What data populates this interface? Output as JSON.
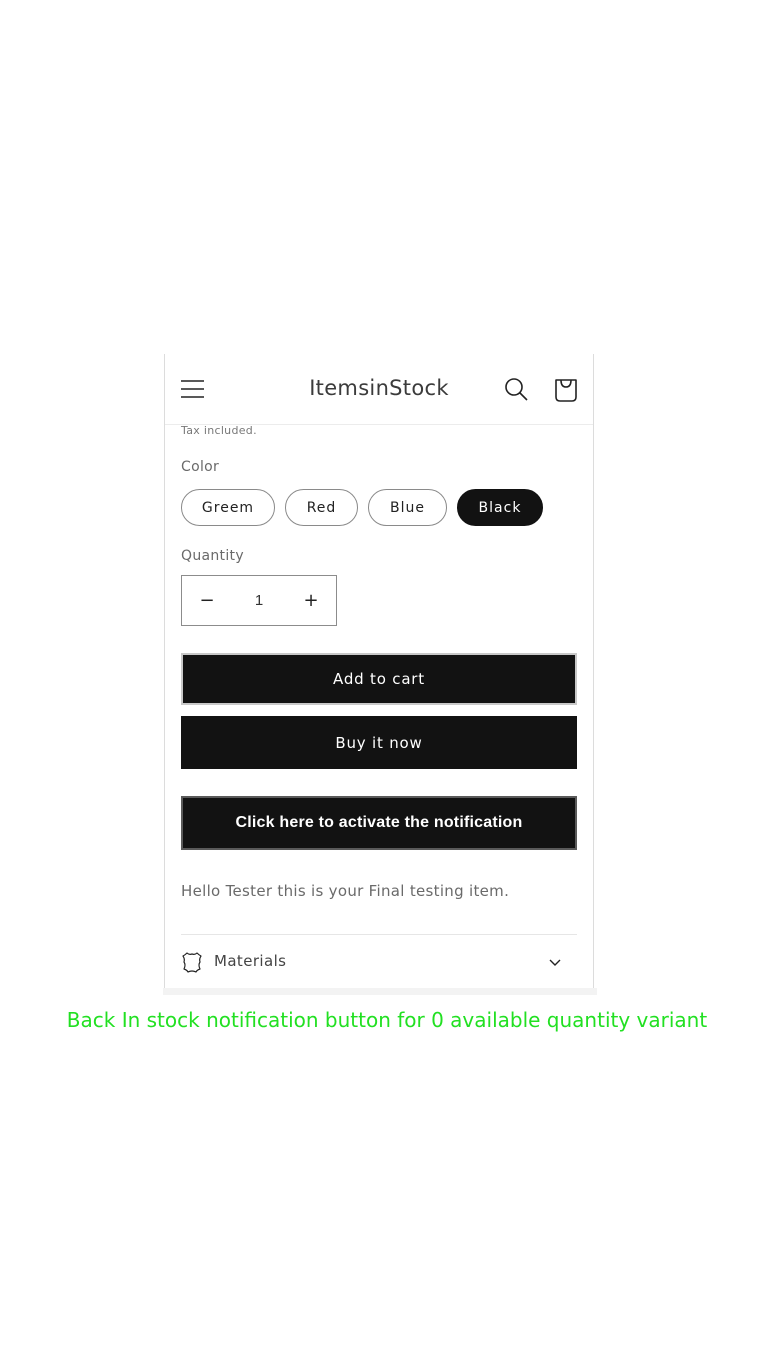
{
  "header": {
    "store_name": "ItemsinStock",
    "icons": [
      "hamburger-menu-icon",
      "search-icon",
      "cart-bag-icon"
    ]
  },
  "product": {
    "tax_note": "Tax included.",
    "color_label": "Color",
    "colors": [
      {
        "label": "Greem",
        "selected": false
      },
      {
        "label": "Red",
        "selected": false
      },
      {
        "label": "Blue",
        "selected": false
      },
      {
        "label": "Black",
        "selected": true
      }
    ],
    "quantity_label": "Quantity",
    "quantity_value": "1",
    "decrease_symbol": "−",
    "increase_symbol": "+",
    "add_to_cart_label": "Add to cart",
    "buy_now_label": "Buy it now",
    "notify_label": "Click here to activate the notification",
    "description": "Hello Tester this is your Final testing item.",
    "accordion": {
      "label": "Materials",
      "icon": "leather-hide-icon"
    }
  },
  "caption": "Back In stock notification button for 0 available quantity variant",
  "colors": {
    "primary_button": "#121212",
    "caption_text": "#22e022"
  }
}
